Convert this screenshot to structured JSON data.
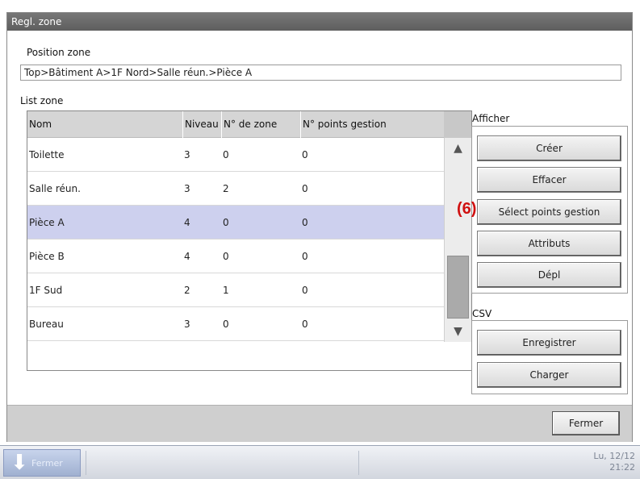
{
  "window": {
    "title": "Regl. zone"
  },
  "position_zone": {
    "label": "Position zone",
    "path": "Top>Bâtiment A>1F Nord>Salle réun.>Pièce A"
  },
  "list_zone": {
    "label": "List zone",
    "columns": [
      "Nom",
      "Niveau",
      "N° de zone",
      "N° points gestion"
    ],
    "rows": [
      {
        "name": "Toilette",
        "level": "3",
        "zone_no": "0",
        "points": "0",
        "selected": false
      },
      {
        "name": "Salle réun.",
        "level": "3",
        "zone_no": "2",
        "points": "0",
        "selected": false
      },
      {
        "name": "Pièce A",
        "level": "4",
        "zone_no": "0",
        "points": "0",
        "selected": true
      },
      {
        "name": "Pièce B",
        "level": "4",
        "zone_no": "0",
        "points": "0",
        "selected": false
      },
      {
        "name": "1F Sud",
        "level": "2",
        "zone_no": "1",
        "points": "0",
        "selected": false
      },
      {
        "name": "Bureau",
        "level": "3",
        "zone_no": "0",
        "points": "0",
        "selected": false
      }
    ]
  },
  "afficher": {
    "label": "Afficher",
    "buttons": [
      "Créer",
      "Effacer",
      "Sélect points gestion",
      "Attributs",
      "Dépl"
    ]
  },
  "annotation": "(6)",
  "csv": {
    "label": "CSV",
    "buttons": [
      "Enregistrer",
      "Charger"
    ]
  },
  "footer": {
    "close_label": "Fermer"
  },
  "taskbar": {
    "app_label": "Fermer",
    "clock_date": "Lu, 12/12",
    "clock_time": "21:22"
  },
  "colors": {
    "selected_row": "#cdd0ee",
    "title_bar": "#6a6a6a",
    "annotation": "#d01010"
  },
  "icons": {
    "taskbar": "down-arrow-icon",
    "scroll_up": "triangle-up-icon",
    "scroll_down": "triangle-down-icon"
  }
}
